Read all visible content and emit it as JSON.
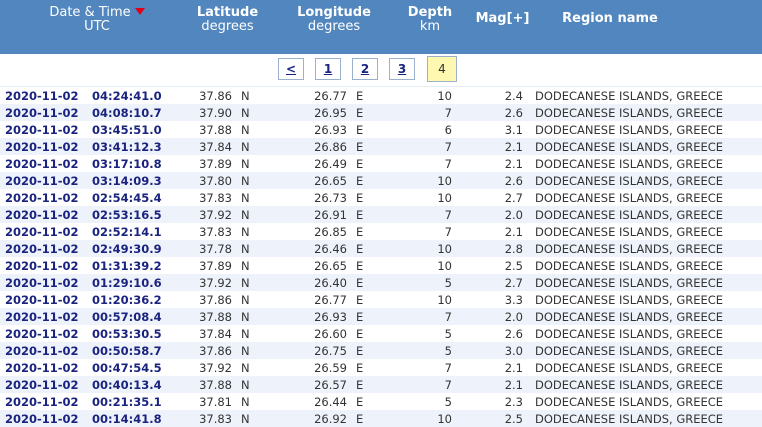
{
  "header": {
    "date_title": "Date & Time",
    "date_sub": "UTC",
    "lat_title": "Latitude",
    "lat_sub": "degrees",
    "lon_title": "Longitude",
    "lon_sub": "degrees",
    "depth_title": "Depth",
    "depth_sub": "km",
    "mag_title": "Mag[+]",
    "region_title": "Region name"
  },
  "pager": {
    "prev": "<",
    "pages": [
      "1",
      "2",
      "3",
      "4"
    ],
    "current": "4"
  },
  "rows": [
    {
      "date": "2020-11-02",
      "time": "04:24:41.0",
      "lat": "37.86",
      "ns": "N",
      "lon": "26.77",
      "ew": "E",
      "depth": "10",
      "mag": "2.4",
      "region": "DODECANESE ISLANDS, GREECE"
    },
    {
      "date": "2020-11-02",
      "time": "04:08:10.7",
      "lat": "37.90",
      "ns": "N",
      "lon": "26.95",
      "ew": "E",
      "depth": "7",
      "mag": "2.6",
      "region": "DODECANESE ISLANDS, GREECE"
    },
    {
      "date": "2020-11-02",
      "time": "03:45:51.0",
      "lat": "37.88",
      "ns": "N",
      "lon": "26.93",
      "ew": "E",
      "depth": "6",
      "mag": "3.1",
      "region": "DODECANESE ISLANDS, GREECE"
    },
    {
      "date": "2020-11-02",
      "time": "03:41:12.3",
      "lat": "37.84",
      "ns": "N",
      "lon": "26.86",
      "ew": "E",
      "depth": "7",
      "mag": "2.1",
      "region": "DODECANESE ISLANDS, GREECE"
    },
    {
      "date": "2020-11-02",
      "time": "03:17:10.8",
      "lat": "37.89",
      "ns": "N",
      "lon": "26.49",
      "ew": "E",
      "depth": "7",
      "mag": "2.1",
      "region": "DODECANESE ISLANDS, GREECE"
    },
    {
      "date": "2020-11-02",
      "time": "03:14:09.3",
      "lat": "37.80",
      "ns": "N",
      "lon": "26.65",
      "ew": "E",
      "depth": "10",
      "mag": "2.6",
      "region": "DODECANESE ISLANDS, GREECE"
    },
    {
      "date": "2020-11-02",
      "time": "02:54:45.4",
      "lat": "37.83",
      "ns": "N",
      "lon": "26.73",
      "ew": "E",
      "depth": "10",
      "mag": "2.7",
      "region": "DODECANESE ISLANDS, GREECE"
    },
    {
      "date": "2020-11-02",
      "time": "02:53:16.5",
      "lat": "37.92",
      "ns": "N",
      "lon": "26.91",
      "ew": "E",
      "depth": "7",
      "mag": "2.0",
      "region": "DODECANESE ISLANDS, GREECE"
    },
    {
      "date": "2020-11-02",
      "time": "02:52:14.1",
      "lat": "37.83",
      "ns": "N",
      "lon": "26.85",
      "ew": "E",
      "depth": "7",
      "mag": "2.1",
      "region": "DODECANESE ISLANDS, GREECE"
    },
    {
      "date": "2020-11-02",
      "time": "02:49:30.9",
      "lat": "37.78",
      "ns": "N",
      "lon": "26.46",
      "ew": "E",
      "depth": "10",
      "mag": "2.8",
      "region": "DODECANESE ISLANDS, GREECE"
    },
    {
      "date": "2020-11-02",
      "time": "01:31:39.2",
      "lat": "37.89",
      "ns": "N",
      "lon": "26.65",
      "ew": "E",
      "depth": "10",
      "mag": "2.5",
      "region": "DODECANESE ISLANDS, GREECE"
    },
    {
      "date": "2020-11-02",
      "time": "01:29:10.6",
      "lat": "37.92",
      "ns": "N",
      "lon": "26.40",
      "ew": "E",
      "depth": "5",
      "mag": "2.7",
      "region": "DODECANESE ISLANDS, GREECE"
    },
    {
      "date": "2020-11-02",
      "time": "01:20:36.2",
      "lat": "37.86",
      "ns": "N",
      "lon": "26.77",
      "ew": "E",
      "depth": "10",
      "mag": "3.3",
      "region": "DODECANESE ISLANDS, GREECE"
    },
    {
      "date": "2020-11-02",
      "time": "00:57:08.4",
      "lat": "37.88",
      "ns": "N",
      "lon": "26.93",
      "ew": "E",
      "depth": "7",
      "mag": "2.0",
      "region": "DODECANESE ISLANDS, GREECE"
    },
    {
      "date": "2020-11-02",
      "time": "00:53:30.5",
      "lat": "37.84",
      "ns": "N",
      "lon": "26.60",
      "ew": "E",
      "depth": "5",
      "mag": "2.6",
      "region": "DODECANESE ISLANDS, GREECE"
    },
    {
      "date": "2020-11-02",
      "time": "00:50:58.7",
      "lat": "37.86",
      "ns": "N",
      "lon": "26.75",
      "ew": "E",
      "depth": "5",
      "mag": "3.0",
      "region": "DODECANESE ISLANDS, GREECE"
    },
    {
      "date": "2020-11-02",
      "time": "00:47:54.5",
      "lat": "37.92",
      "ns": "N",
      "lon": "26.59",
      "ew": "E",
      "depth": "7",
      "mag": "2.1",
      "region": "DODECANESE ISLANDS, GREECE"
    },
    {
      "date": "2020-11-02",
      "time": "00:40:13.4",
      "lat": "37.88",
      "ns": "N",
      "lon": "26.57",
      "ew": "E",
      "depth": "7",
      "mag": "2.1",
      "region": "DODECANESE ISLANDS, GREECE"
    },
    {
      "date": "2020-11-02",
      "time": "00:21:35.1",
      "lat": "37.81",
      "ns": "N",
      "lon": "26.44",
      "ew": "E",
      "depth": "5",
      "mag": "2.3",
      "region": "DODECANESE ISLANDS, GREECE"
    },
    {
      "date": "2020-11-02",
      "time": "00:14:41.8",
      "lat": "37.83",
      "ns": "N",
      "lon": "26.92",
      "ew": "E",
      "depth": "10",
      "mag": "2.5",
      "region": "DODECANESE ISLANDS, GREECE"
    }
  ]
}
